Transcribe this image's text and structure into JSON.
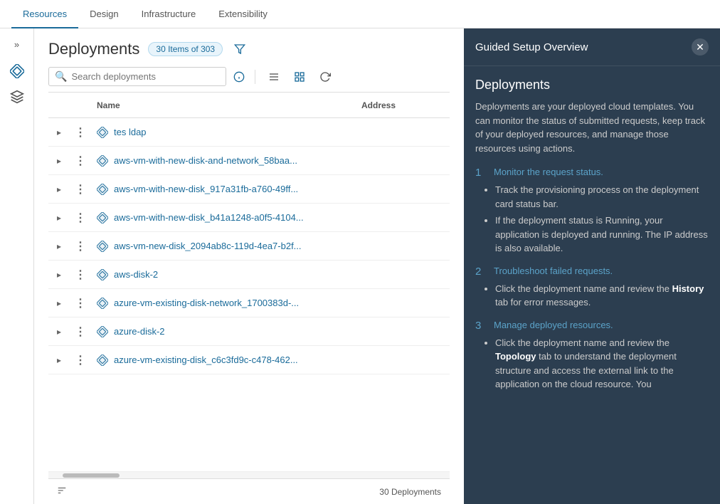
{
  "topNav": {
    "items": [
      {
        "label": "Resources",
        "active": true
      },
      {
        "label": "Design",
        "active": false
      },
      {
        "label": "Infrastructure",
        "active": false
      },
      {
        "label": "Extensibility",
        "active": false
      }
    ]
  },
  "sidebar": {
    "toggleLabel": ">>",
    "icons": [
      {
        "name": "diamond-icon",
        "symbol": "◈"
      },
      {
        "name": "box-icon",
        "symbol": "⬡"
      }
    ]
  },
  "pageHeader": {
    "title": "Deployments",
    "badge": "30 Items of 303"
  },
  "toolbar": {
    "searchPlaceholder": "Search deployments",
    "infoLabel": "ⓘ",
    "listViewLabel": "≡",
    "gridViewLabel": "⊞",
    "refreshLabel": "↻"
  },
  "table": {
    "columns": [
      {
        "key": "name",
        "label": "Name"
      },
      {
        "key": "address",
        "label": "Address"
      }
    ],
    "rows": [
      {
        "name": "tes ldap",
        "address": ""
      },
      {
        "name": "aws-vm-with-new-disk-and-network_58baa...",
        "address": ""
      },
      {
        "name": "aws-vm-with-new-disk_917a31fb-a760-49ff...",
        "address": ""
      },
      {
        "name": "aws-vm-with-new-disk_b41a1248-a0f5-4104...",
        "address": ""
      },
      {
        "name": "aws-vm-new-disk_2094ab8c-119d-4ea7-b2f...",
        "address": ""
      },
      {
        "name": "aws-disk-2",
        "address": ""
      },
      {
        "name": "azure-vm-existing-disk-network_1700383d-...",
        "address": ""
      },
      {
        "name": "azure-disk-2",
        "address": ""
      },
      {
        "name": "azure-vm-existing-disk_c6c3fd9c-c478-462...",
        "address": ""
      }
    ],
    "footerCount": "30 Deployments"
  },
  "guidedPanel": {
    "title": "Guided Setup Overview",
    "sectionTitle": "Deployments",
    "description": "Deployments are your deployed cloud templates. You can monitor the status of submitted requests, keep track of your deployed resources, and manage those resources using actions.",
    "steps": [
      {
        "num": "1",
        "title": "Monitor the request status.",
        "bullets": [
          "Track the provisioning process on the deployment card status bar.",
          "If the deployment status is Running, your application is deployed and running. The IP address is also available."
        ]
      },
      {
        "num": "2",
        "title": "Troubleshoot failed requests.",
        "bullets": [
          {
            "text": "Click the deployment name and review the ",
            "bold": "History",
            "text2": " tab for error messages."
          }
        ]
      },
      {
        "num": "3",
        "title": "Manage deployed resources.",
        "bullets": [
          {
            "text": "Click the deployment name and review the ",
            "bold": "Topology",
            "text2": " tab to understand the deployment structure and access the external link to the application on the cloud resource. You"
          }
        ]
      }
    ]
  }
}
